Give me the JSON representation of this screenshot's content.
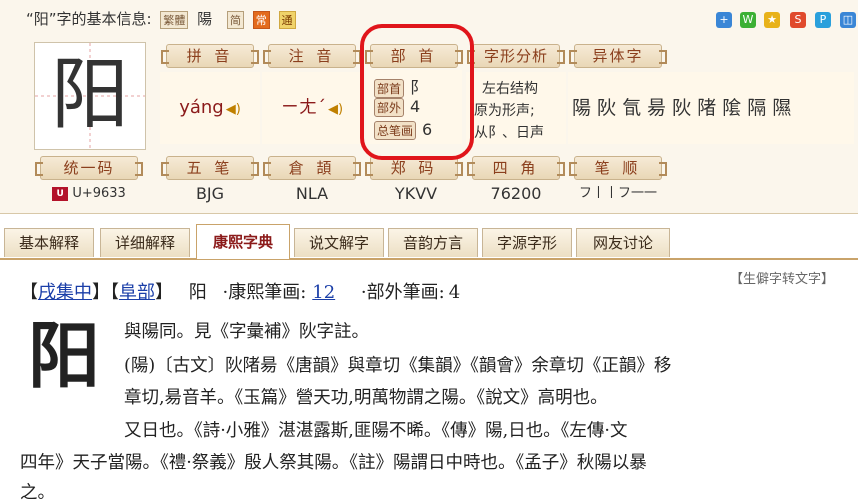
{
  "header": {
    "title": "“阳”字的基本信息:",
    "badge_fanti": "繁體",
    "trad_char": "陽",
    "badge_small": "简",
    "badge_common": "常",
    "badge_tong": "通"
  },
  "share_icons": [
    "+",
    "W",
    "★",
    "S",
    "P",
    "◫"
  ],
  "big_char": "阳",
  "sections": {
    "pinyin": {
      "label": "拼 音",
      "value": "yáng"
    },
    "zhuyin": {
      "label": "注 音",
      "value": "ㄧㄤˊ"
    },
    "radical": {
      "label": "部 首",
      "bushou_tag": "部首",
      "bushou": "阝",
      "buwai_tag": "部外",
      "buwai": "4",
      "total_tag": "总笔画",
      "total": "6"
    },
    "structure": {
      "label": "字形分析",
      "line1": "左右结构",
      "line2": "原为形声;",
      "line3": "从阝、日声"
    },
    "variants": {
      "label": "异体字",
      "value": "陽 阦 氜 昜 阦 陼 隂 隔 隰"
    }
  },
  "codes": {
    "unicode": {
      "label": "统一码",
      "value": "U+9633"
    },
    "wubi": {
      "label": "五 笔",
      "value": "BJG"
    },
    "cangjie": {
      "label": "倉 頡",
      "value": "NLA"
    },
    "zhengma": {
      "label": "郑 码",
      "value": "YKVV"
    },
    "sijiao": {
      "label": "四 角",
      "value": "76200"
    },
    "bishun": {
      "label": "笔 顺",
      "value": "フ丨丨フ一一"
    }
  },
  "tabs": [
    "基本解释",
    "详细解释",
    "康熙字典",
    "说文解字",
    "音韵方言",
    "字源字形",
    "网友讨论"
  ],
  "active_tab": "康熙字典",
  "kangxi": {
    "convert_link": "【生僻字转文字】",
    "head_open": "【",
    "collection": "戌集中",
    "head_mid": "】【",
    "radical": "阜部",
    "head_close": "】",
    "char": "阳",
    "strokes_label": "·康熙筆画:",
    "strokes": "12",
    "outer_label": "·部外筆画:",
    "outer": "4",
    "line1": "與陽同。見《字彙補》阦字註。",
    "line2": "(陽)〔古文〕阦陼昜《唐韻》與章切《集韻》《韻會》余章切《正韻》移",
    "line3": "章切,昜音羊。《玉篇》營天功,明萬物謂之陽。《說文》高明也。",
    "line4": "又日也。《詩·小雅》湛湛露斯,匪陽不晞。《傳》陽,日也。《左傳·文",
    "line5": "四年》天子當陽。《禮·祭義》殷人祭其陽。《註》陽謂日中時也。《孟子》秋陽以暴",
    "line6": "之。",
    "big_char": "阳"
  }
}
